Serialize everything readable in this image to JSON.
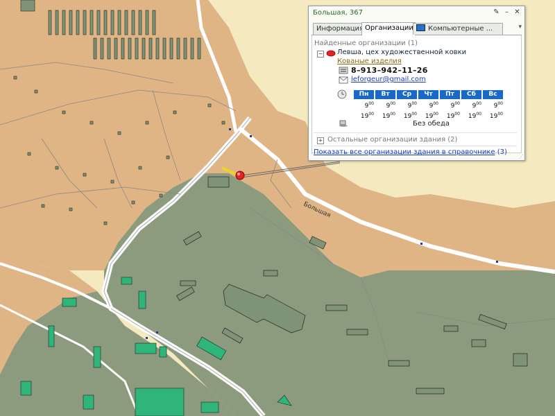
{
  "window": {
    "title": "Большая, 367",
    "buttons": [
      "pin-icon",
      "minimize-icon",
      "close-icon"
    ]
  },
  "tabs": [
    {
      "label": "Информация",
      "active": false
    },
    {
      "label": "Организации",
      "active": true
    },
    {
      "label": "Компьютерные ...",
      "active": false
    }
  ],
  "tabs_more": "▾",
  "panel": {
    "found_label": "Найденные организации (1)",
    "org": {
      "name": "Левша, цех художественной ковки",
      "category": "Кованые изделия",
      "phone": "8–913–942–11–26",
      "email": "leforgeur@gmail.com",
      "days": [
        "Пн",
        "Вт",
        "Ср",
        "Чт",
        "Пт",
        "Сб",
        "Вс"
      ],
      "open": [
        "9",
        "9",
        "9",
        "9",
        "9",
        "9",
        "9"
      ],
      "close": [
        "19",
        "19",
        "19",
        "19",
        "19",
        "19",
        "19"
      ],
      "minutes": "00",
      "lunch": "Без обеда"
    },
    "others_label": "Остальные организации здания (2)",
    "show_all_link": "Показать все организации здания в справочнике",
    "show_all_count": "(3)"
  },
  "map": {
    "street_label": "Большая",
    "colors": {
      "background": "#f5e9c0",
      "district": "#e0b585",
      "forest": "#8c9a7e",
      "road": "#ffffff",
      "building": "#7f9476",
      "green_building": "#2fb57a",
      "marker": "#e82020"
    }
  }
}
